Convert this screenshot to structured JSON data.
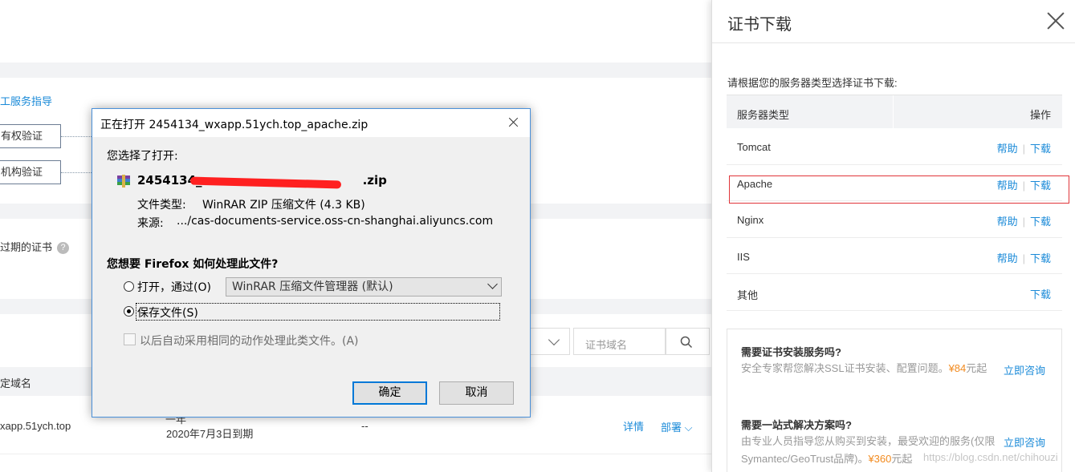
{
  "background": {
    "service_guide": "工服务指导",
    "ownership_verify": "有权验证",
    "org_verify": "机构验证",
    "expired_certs": "过期的证书",
    "domain_placeholder": "证书域名",
    "col_domain": "定域名",
    "row_domain": "xapp.51ych.top",
    "row_year": "一年",
    "row_expiry": "2020年7月3日到期",
    "row_status": "--",
    "row_detail": "详情",
    "row_deploy": "部署"
  },
  "panel": {
    "title": "证书下载",
    "intro": "请根据您的服务器类型选择证书下载:",
    "col_server_type": "服务器类型",
    "col_action": "操作",
    "rows": [
      {
        "name": "Tomcat",
        "help": "帮助",
        "download": "下载"
      },
      {
        "name": "Apache",
        "help": "帮助",
        "download": "下载"
      },
      {
        "name": "Nginx",
        "help": "帮助",
        "download": "下载"
      },
      {
        "name": "IIS",
        "help": "帮助",
        "download": "下载"
      },
      {
        "name": "其他",
        "help": "",
        "download": "下载"
      }
    ],
    "promo1": {
      "title": "需要证书安装服务吗?",
      "desc_a": "安全专家帮您解决SSL证书安装、配置问题。",
      "price": "¥84",
      "desc_b": "元起",
      "consult": "立即咨询"
    },
    "promo2": {
      "title": "需要一站式解决方案吗?",
      "desc_a": "由专业人员指导您从购买到安装，最受欢迎的服务(仅限Symantec/GeoTrust品牌)。",
      "price": "¥360",
      "desc_b": "元起",
      "consult": "立即咨询"
    },
    "watermark": "https://blog.csdn.net/chihouzi"
  },
  "dialog": {
    "title": "正在打开 2454134_wxapp.51ych.top_apache.zip",
    "chosen_label": "您选择了打开:",
    "filename_visible_start": "2454134_",
    "filename_visible_end": ".zip",
    "file_type_label": "文件类型:",
    "file_type_value": "WinRAR ZIP 压缩文件 (4.3 KB)",
    "source_label": "来源:",
    "source_value": ".../cas-documents-service.oss-cn-shanghai.aliyuncs.com",
    "question": "您想要 Firefox 如何处理此文件?",
    "open_with_label": "打开，通过(O)",
    "open_with_app": "WinRAR 压缩文件管理器 (默认)",
    "save_file_label": "保存文件(S)",
    "auto_label": "以后自动采用相同的动作处理此类文件。(A)",
    "ok_label": "确定",
    "cancel_label": "取消",
    "selected_option": "save"
  },
  "colors": {
    "link": "#1a8ad8",
    "price": "#f28b20",
    "highlight": "#e0353a",
    "dialog_border": "#4a90d9"
  }
}
